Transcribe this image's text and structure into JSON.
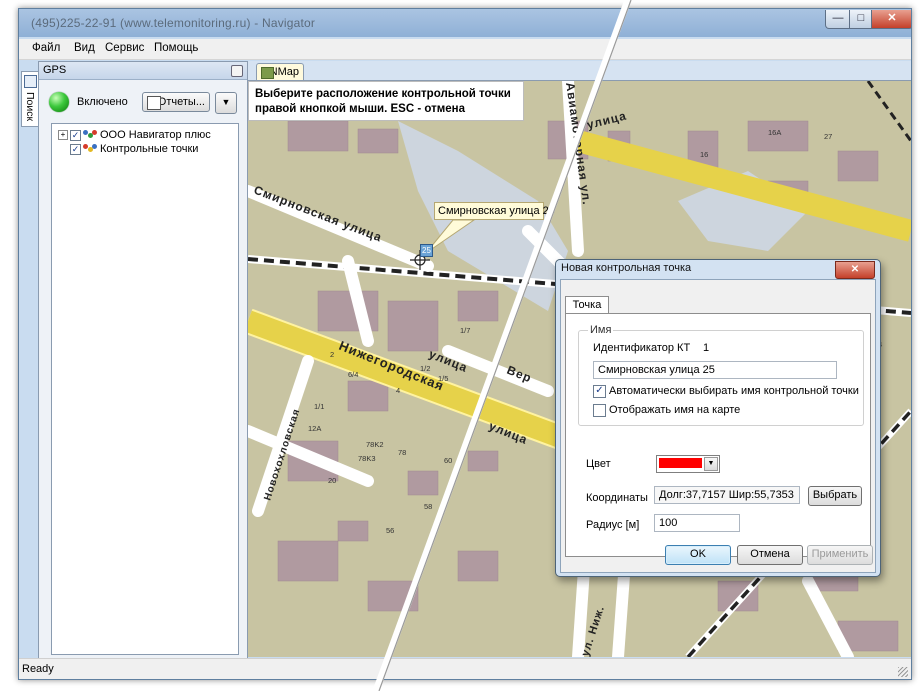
{
  "window": {
    "title": "(495)225-22-91 (www.telemonitoring.ru) - Navigator",
    "min_glyph": "—",
    "max_glyph": "□",
    "close_glyph": "✕"
  },
  "menu": [
    "Файл",
    "Вид",
    "Сервис",
    "Помощь"
  ],
  "side_tab": {
    "label": "Поиск"
  },
  "gps_panel": {
    "title": "GPS",
    "status_label": "Включено",
    "reports_button": "Отчеты...",
    "dropdown_glyph": "▼",
    "tree": [
      {
        "expander": "+",
        "checked": "✓",
        "label": "ООО Навигатор плюс"
      },
      {
        "expander": "",
        "checked": "✓",
        "label": "Контрольные точки"
      }
    ]
  },
  "map": {
    "tab_label": "NMap",
    "hint": "Выберите расположение контрольной точки правой кнопкой мыши. ESC - отмена",
    "callout": "Смирновская улица 25",
    "point_badge": "25",
    "street_labels": [
      "Смирновская улица",
      "Нижегородская",
      "улица",
      "улица",
      "Вер",
      "Новохохловская",
      "Авиамоторная ул.",
      "улица",
      "ул. Ниж."
    ],
    "house_numbers": [
      "16A",
      "27",
      "16",
      "6/4",
      "4",
      "1/2",
      "1/5",
      "12A",
      "78K2",
      "78K3",
      "78",
      "60",
      "20",
      "56",
      "58",
      "106K3",
      "1/7",
      "16",
      "4",
      "2",
      "1/1"
    ]
  },
  "dialog": {
    "title": "Новая контрольная точка",
    "close_glyph": "✕",
    "tab": "Точка",
    "group_caption": "Имя",
    "id_label": "Идентификатор КТ",
    "id_value": "1",
    "name_value": "Смирновская улица 25",
    "auto_name_label": "Автоматически выбирать имя контрольной точки",
    "auto_name_checked": "✓",
    "show_name_label": "Отображать имя на карте",
    "show_name_checked": "",
    "color_label": "Цвет",
    "color_value": "#ff0000",
    "coords_label": "Координаты",
    "coords_value": "Долг:37,7157 Шир:55,7353",
    "choose_button": "Выбрать",
    "radius_label": "Радиус [м]",
    "radius_value": "100",
    "ok_button": "OK",
    "cancel_button": "Отмена",
    "apply_button": "Применить"
  },
  "status": {
    "text": "Ready"
  }
}
